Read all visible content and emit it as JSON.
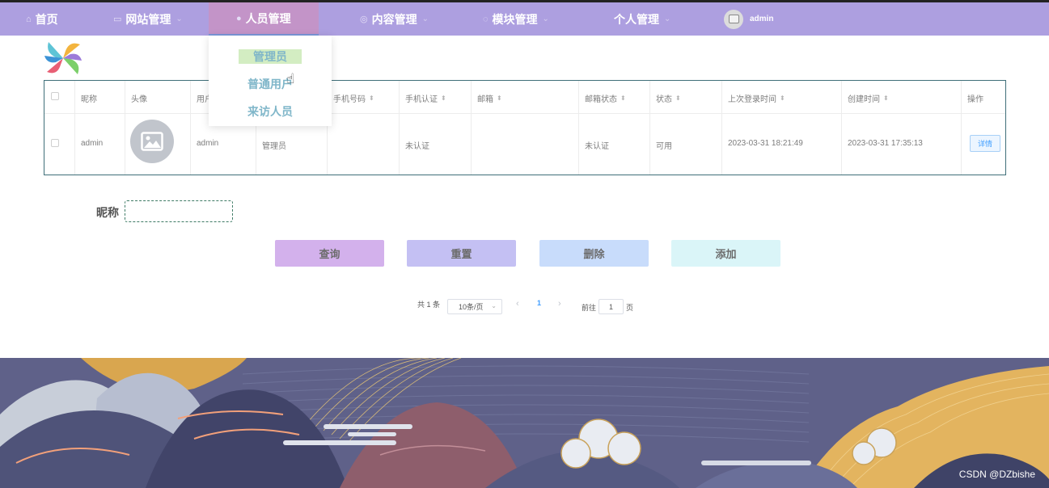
{
  "nav": {
    "items": [
      {
        "label": "首页",
        "icon": "home-icon"
      },
      {
        "label": "网站管理",
        "icon": "monitor-icon"
      },
      {
        "label": "人员管理",
        "icon": "user-icon"
      },
      {
        "label": "内容管理",
        "icon": "content-icon"
      },
      {
        "label": "模块管理",
        "icon": "module-icon"
      },
      {
        "label": "个人管理",
        "icon": ""
      }
    ],
    "user": "admin",
    "colors": {
      "bar": "#ad9fe0",
      "active": "#c394c8"
    }
  },
  "dropdown": {
    "items": [
      "管理员",
      "普通用户",
      "来访人员"
    ],
    "highlighted": "管理员"
  },
  "table": {
    "headers": [
      "昵称",
      "头像",
      "用户",
      "手机号码",
      "手机认证",
      "邮箱",
      "邮箱状态",
      "状态",
      "上次登录时间",
      "创建时间",
      "操作"
    ],
    "rows": [
      {
        "nickname": "admin",
        "username": "admin",
        "role": "管理员",
        "phone": "",
        "phone_auth": "未认证",
        "email": "",
        "email_status": "未认证",
        "status": "可用",
        "last_login": "2023-03-31 18:21:49",
        "created": "2023-03-31 17:35:13",
        "action": "详情"
      }
    ]
  },
  "search": {
    "label": "昵称",
    "value": ""
  },
  "buttons": {
    "query": "查询",
    "reset": "重置",
    "delete": "删除",
    "add": "添加"
  },
  "pagination": {
    "total": "共 1 条",
    "page_size": "10条/页",
    "prev": "‹",
    "current": "1",
    "next": "›",
    "goto_prefix": "前往",
    "goto_value": "1",
    "goto_suffix": "页"
  },
  "watermark": "CSDN @DZbishe"
}
